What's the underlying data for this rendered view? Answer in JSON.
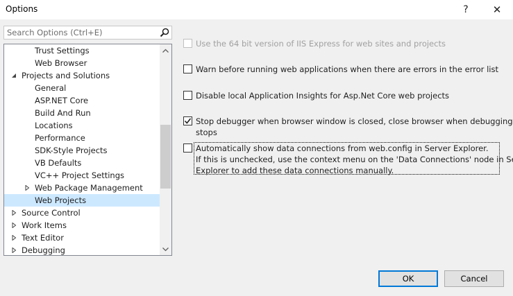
{
  "window": {
    "title": "Options",
    "help_glyph": "?",
    "close_glyph": "✕"
  },
  "search": {
    "placeholder": "Search Options (Ctrl+E)"
  },
  "tree": {
    "items": [
      {
        "label": "Trust Settings",
        "indent": 2,
        "expander": "none",
        "selected": false
      },
      {
        "label": "Web Browser",
        "indent": 2,
        "expander": "none",
        "selected": false
      },
      {
        "label": "Projects and Solutions",
        "indent": 1,
        "expander": "expanded",
        "selected": false
      },
      {
        "label": "General",
        "indent": 2,
        "expander": "none",
        "selected": false
      },
      {
        "label": "ASP.NET Core",
        "indent": 2,
        "expander": "none",
        "selected": false
      },
      {
        "label": "Build And Run",
        "indent": 2,
        "expander": "none",
        "selected": false
      },
      {
        "label": "Locations",
        "indent": 2,
        "expander": "none",
        "selected": false
      },
      {
        "label": "Performance",
        "indent": 2,
        "expander": "none",
        "selected": false
      },
      {
        "label": "SDK-Style Projects",
        "indent": 2,
        "expander": "none",
        "selected": false
      },
      {
        "label": "VB Defaults",
        "indent": 2,
        "expander": "none",
        "selected": false
      },
      {
        "label": "VC++ Project Settings",
        "indent": 2,
        "expander": "none",
        "selected": false
      },
      {
        "label": "Web Package Management",
        "indent": 2,
        "expander": "collapsed",
        "selected": false
      },
      {
        "label": "Web Projects",
        "indent": 2,
        "expander": "none",
        "selected": true
      },
      {
        "label": "Source Control",
        "indent": 1,
        "expander": "collapsed",
        "selected": false
      },
      {
        "label": "Work Items",
        "indent": 1,
        "expander": "collapsed",
        "selected": false
      },
      {
        "label": "Text Editor",
        "indent": 1,
        "expander": "collapsed",
        "selected": false
      },
      {
        "label": "Debugging",
        "indent": 1,
        "expander": "collapsed",
        "selected": false
      }
    ]
  },
  "options": [
    {
      "label": "Use the 64 bit version of IIS Express for web sites and projects",
      "checked": false,
      "enabled": false
    },
    {
      "label": "Warn before running web applications when there are errors in the error list",
      "checked": false,
      "enabled": true
    },
    {
      "label": "Disable local Application Insights for Asp.Net Core web projects",
      "checked": false,
      "enabled": true
    },
    {
      "label": "Stop debugger when browser window is closed, close browser when debugging",
      "label_line2": "stops",
      "checked": true,
      "enabled": true
    },
    {
      "label": "Automatically show data connections from web.config in Server Explorer.",
      "label_line2": "If this is unchecked, use the context menu on the 'Data Connections' node in Server",
      "label_line3": "Explorer to add these data connections manually.",
      "checked": false,
      "enabled": true
    }
  ],
  "buttons": {
    "ok": "OK",
    "cancel": "Cancel"
  }
}
